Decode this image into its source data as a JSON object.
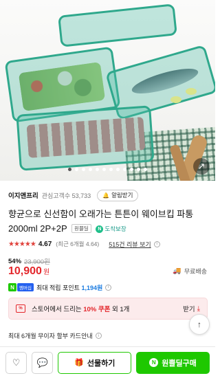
{
  "hero": {
    "image_alt": "green food storage containers with vegetables, fish and meat",
    "slide_count": 12,
    "active_slide": 1,
    "share_icon": "share-icon"
  },
  "store": {
    "name": "이지앤프리",
    "favorite_label": "관심고객수 53,733",
    "alarm_label": "알림받기"
  },
  "product": {
    "title": "향균으로 신선함이 오래가는 튼튼이 웨이브킵 파통 2000ml 2P+2P",
    "return_badge": "원쁠딜",
    "arrive_badge": "도착보장",
    "arrive_logo": "N"
  },
  "rating": {
    "stars": "★★★★★",
    "score": "4.67",
    "note": "(최근 6개월 4.64)",
    "review_link": "515건 리뷰 보기",
    "info": "i"
  },
  "price": {
    "discount": "54%",
    "original": "23,900원",
    "current": "10,900",
    "unit": "원",
    "shipping": "무료배송"
  },
  "points": {
    "npay_logo": "N",
    "plus_badge": "멤버십",
    "text_prefix": "최대 적립 포인트",
    "amount": "1,194원",
    "info": "i"
  },
  "coupon": {
    "icon_label": "%",
    "text_prefix": "스토어에서 드리는",
    "highlight": "10% 쿠폰",
    "text_suffix": "외 1개",
    "download_label": "받기"
  },
  "card": {
    "text": "최대 6개월 무이자 할부 카드안내",
    "info": "i"
  },
  "bottom": {
    "gift_label": "선물하기",
    "buy_label": "원쁠딜구매",
    "buy_logo": "N"
  },
  "colors": {
    "brand_green": "#1ec800",
    "price_red": "#e3262b",
    "container_teal": "#2fa88c"
  }
}
